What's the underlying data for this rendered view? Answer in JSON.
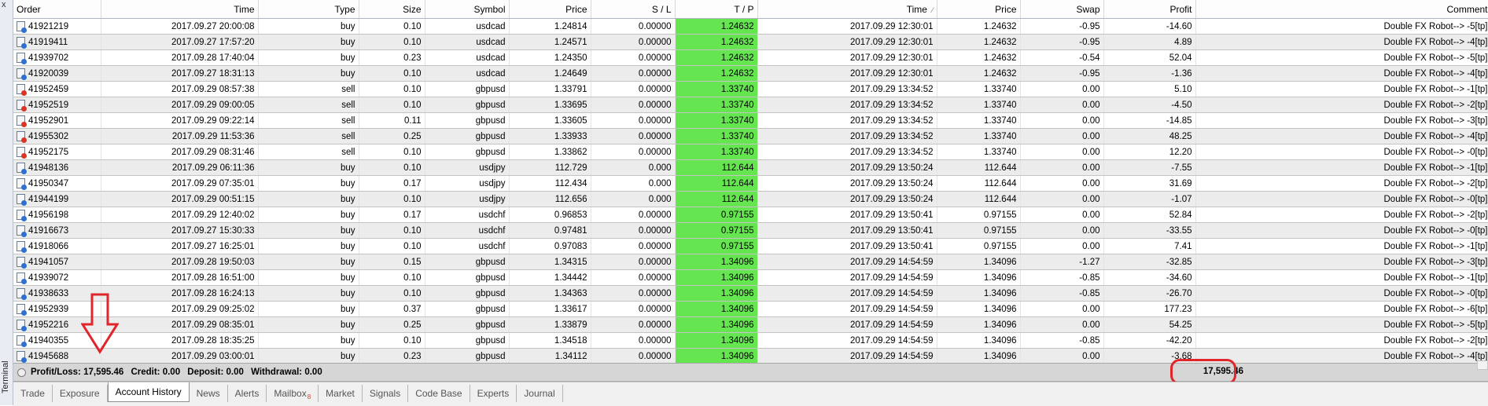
{
  "window": {
    "close_glyph": "x",
    "side_label": "Terminal"
  },
  "columns": [
    "Order",
    "Time",
    "Type",
    "Size",
    "Symbol",
    "Price",
    "S / L",
    "T / P",
    "Time",
    "Price",
    "Swap",
    "Profit",
    "Comment"
  ],
  "rows": [
    {
      "order": "41921219",
      "time": "2017.09.27 20:00:08",
      "type": "buy",
      "size": "0.10",
      "symbol": "usdcad",
      "price": "1.24814",
      "sl": "0.00000",
      "tp": "1.24632",
      "close_time": "2017.09.29 12:30:01",
      "close_price": "1.24632",
      "swap": "-0.95",
      "profit": "-14.60",
      "comment": "Double FX Robot--> -5[tp]"
    },
    {
      "order": "41919411",
      "time": "2017.09.27 17:57:20",
      "type": "buy",
      "size": "0.10",
      "symbol": "usdcad",
      "price": "1.24571",
      "sl": "0.00000",
      "tp": "1.24632",
      "close_time": "2017.09.29 12:30:01",
      "close_price": "1.24632",
      "swap": "-0.95",
      "profit": "4.89",
      "comment": "Double FX Robot--> -4[tp]"
    },
    {
      "order": "41939702",
      "time": "2017.09.28 17:40:04",
      "type": "buy",
      "size": "0.23",
      "symbol": "usdcad",
      "price": "1.24350",
      "sl": "0.00000",
      "tp": "1.24632",
      "close_time": "2017.09.29 12:30:01",
      "close_price": "1.24632",
      "swap": "-0.54",
      "profit": "52.04",
      "comment": "Double FX Robot--> -5[tp]"
    },
    {
      "order": "41920039",
      "time": "2017.09.27 18:31:13",
      "type": "buy",
      "size": "0.10",
      "symbol": "usdcad",
      "price": "1.24649",
      "sl": "0.00000",
      "tp": "1.24632",
      "close_time": "2017.09.29 12:30:01",
      "close_price": "1.24632",
      "swap": "-0.95",
      "profit": "-1.36",
      "comment": "Double FX Robot--> -4[tp]"
    },
    {
      "order": "41952459",
      "time": "2017.09.29 08:57:38",
      "type": "sell",
      "size": "0.10",
      "symbol": "gbpusd",
      "price": "1.33791",
      "sl": "0.00000",
      "tp": "1.33740",
      "close_time": "2017.09.29 13:34:52",
      "close_price": "1.33740",
      "swap": "0.00",
      "profit": "5.10",
      "comment": "Double FX Robot--> -1[tp]"
    },
    {
      "order": "41952519",
      "time": "2017.09.29 09:00:05",
      "type": "sell",
      "size": "0.10",
      "symbol": "gbpusd",
      "price": "1.33695",
      "sl": "0.00000",
      "tp": "1.33740",
      "close_time": "2017.09.29 13:34:52",
      "close_price": "1.33740",
      "swap": "0.00",
      "profit": "-4.50",
      "comment": "Double FX Robot--> -2[tp]"
    },
    {
      "order": "41952901",
      "time": "2017.09.29 09:22:14",
      "type": "sell",
      "size": "0.11",
      "symbol": "gbpusd",
      "price": "1.33605",
      "sl": "0.00000",
      "tp": "1.33740",
      "close_time": "2017.09.29 13:34:52",
      "close_price": "1.33740",
      "swap": "0.00",
      "profit": "-14.85",
      "comment": "Double FX Robot--> -3[tp]"
    },
    {
      "order": "41955302",
      "time": "2017.09.29 11:53:36",
      "type": "sell",
      "size": "0.25",
      "symbol": "gbpusd",
      "price": "1.33933",
      "sl": "0.00000",
      "tp": "1.33740",
      "close_time": "2017.09.29 13:34:52",
      "close_price": "1.33740",
      "swap": "0.00",
      "profit": "48.25",
      "comment": "Double FX Robot--> -4[tp]"
    },
    {
      "order": "41952175",
      "time": "2017.09.29 08:31:46",
      "type": "sell",
      "size": "0.10",
      "symbol": "gbpusd",
      "price": "1.33862",
      "sl": "0.00000",
      "tp": "1.33740",
      "close_time": "2017.09.29 13:34:52",
      "close_price": "1.33740",
      "swap": "0.00",
      "profit": "12.20",
      "comment": "Double FX Robot--> -0[tp]"
    },
    {
      "order": "41948136",
      "time": "2017.09.29 06:11:36",
      "type": "buy",
      "size": "0.10",
      "symbol": "usdjpy",
      "price": "112.729",
      "sl": "0.000",
      "tp": "112.644",
      "close_time": "2017.09.29 13:50:24",
      "close_price": "112.644",
      "swap": "0.00",
      "profit": "-7.55",
      "comment": "Double FX Robot--> -1[tp]"
    },
    {
      "order": "41950347",
      "time": "2017.09.29 07:35:01",
      "type": "buy",
      "size": "0.17",
      "symbol": "usdjpy",
      "price": "112.434",
      "sl": "0.000",
      "tp": "112.644",
      "close_time": "2017.09.29 13:50:24",
      "close_price": "112.644",
      "swap": "0.00",
      "profit": "31.69",
      "comment": "Double FX Robot--> -2[tp]"
    },
    {
      "order": "41944199",
      "time": "2017.09.29 00:51:15",
      "type": "buy",
      "size": "0.10",
      "symbol": "usdjpy",
      "price": "112.656",
      "sl": "0.000",
      "tp": "112.644",
      "close_time": "2017.09.29 13:50:24",
      "close_price": "112.644",
      "swap": "0.00",
      "profit": "-1.07",
      "comment": "Double FX Robot--> -0[tp]"
    },
    {
      "order": "41956198",
      "time": "2017.09.29 12:40:02",
      "type": "buy",
      "size": "0.17",
      "symbol": "usdchf",
      "price": "0.96853",
      "sl": "0.00000",
      "tp": "0.97155",
      "close_time": "2017.09.29 13:50:41",
      "close_price": "0.97155",
      "swap": "0.00",
      "profit": "52.84",
      "comment": "Double FX Robot--> -2[tp]"
    },
    {
      "order": "41916673",
      "time": "2017.09.27 15:30:33",
      "type": "buy",
      "size": "0.10",
      "symbol": "usdchf",
      "price": "0.97481",
      "sl": "0.00000",
      "tp": "0.97155",
      "close_time": "2017.09.29 13:50:41",
      "close_price": "0.97155",
      "swap": "0.00",
      "profit": "-33.55",
      "comment": "Double FX Robot--> -0[tp]"
    },
    {
      "order": "41918066",
      "time": "2017.09.27 16:25:01",
      "type": "buy",
      "size": "0.10",
      "symbol": "usdchf",
      "price": "0.97083",
      "sl": "0.00000",
      "tp": "0.97155",
      "close_time": "2017.09.29 13:50:41",
      "close_price": "0.97155",
      "swap": "0.00",
      "profit": "7.41",
      "comment": "Double FX Robot--> -1[tp]"
    },
    {
      "order": "41941057",
      "time": "2017.09.28 19:50:03",
      "type": "buy",
      "size": "0.15",
      "symbol": "gbpusd",
      "price": "1.34315",
      "sl": "0.00000",
      "tp": "1.34096",
      "close_time": "2017.09.29 14:54:59",
      "close_price": "1.34096",
      "swap": "-1.27",
      "profit": "-32.85",
      "comment": "Double FX Robot--> -3[tp]"
    },
    {
      "order": "41939072",
      "time": "2017.09.28 16:51:00",
      "type": "buy",
      "size": "0.10",
      "symbol": "gbpusd",
      "price": "1.34442",
      "sl": "0.00000",
      "tp": "1.34096",
      "close_time": "2017.09.29 14:54:59",
      "close_price": "1.34096",
      "swap": "-0.85",
      "profit": "-34.60",
      "comment": "Double FX Robot--> -1[tp]"
    },
    {
      "order": "41938633",
      "time": "2017.09.28 16:24:13",
      "type": "buy",
      "size": "0.10",
      "symbol": "gbpusd",
      "price": "1.34363",
      "sl": "0.00000",
      "tp": "1.34096",
      "close_time": "2017.09.29 14:54:59",
      "close_price": "1.34096",
      "swap": "-0.85",
      "profit": "-26.70",
      "comment": "Double FX Robot--> -0[tp]"
    },
    {
      "order": "41952939",
      "time": "2017.09.29 09:25:02",
      "type": "buy",
      "size": "0.37",
      "symbol": "gbpusd",
      "price": "1.33617",
      "sl": "0.00000",
      "tp": "1.34096",
      "close_time": "2017.09.29 14:54:59",
      "close_price": "1.34096",
      "swap": "0.00",
      "profit": "177.23",
      "comment": "Double FX Robot--> -6[tp]"
    },
    {
      "order": "41952216",
      "time": "2017.09.29 08:35:01",
      "type": "buy",
      "size": "0.25",
      "symbol": "gbpusd",
      "price": "1.33879",
      "sl": "0.00000",
      "tp": "1.34096",
      "close_time": "2017.09.29 14:54:59",
      "close_price": "1.34096",
      "swap": "0.00",
      "profit": "54.25",
      "comment": "Double FX Robot--> -5[tp]"
    },
    {
      "order": "41940355",
      "time": "2017.09.28 18:35:25",
      "type": "buy",
      "size": "0.10",
      "symbol": "gbpusd",
      "price": "1.34518",
      "sl": "0.00000",
      "tp": "1.34096",
      "close_time": "2017.09.29 14:54:59",
      "close_price": "1.34096",
      "swap": "-0.85",
      "profit": "-42.20",
      "comment": "Double FX Robot--> -2[tp]"
    },
    {
      "order": "41945688",
      "time": "2017.09.29 03:00:01",
      "type": "buy",
      "size": "0.23",
      "symbol": "gbpusd",
      "price": "1.34112",
      "sl": "0.00000",
      "tp": "1.34096",
      "close_time": "2017.09.29 14:54:59",
      "close_price": "1.34096",
      "swap": "0.00",
      "profit": "-3.68",
      "comment": "Double FX Robot--> -4[tp]"
    }
  ],
  "summary": {
    "profit_loss": "Profit/Loss: 17,595.46",
    "credit": "Credit: 0.00",
    "deposit": "Deposit: 0.00",
    "withdrawal": "Withdrawal: 0.00",
    "total_profit": "17,595.46"
  },
  "tabs": [
    {
      "label": "Trade"
    },
    {
      "label": "Exposure"
    },
    {
      "label": "Account History",
      "active": true
    },
    {
      "label": "News"
    },
    {
      "label": "Alerts"
    },
    {
      "label": "Mailbox",
      "badge": "8"
    },
    {
      "label": "Market"
    },
    {
      "label": "Signals"
    },
    {
      "label": "Code Base"
    },
    {
      "label": "Experts"
    },
    {
      "label": "Journal"
    }
  ],
  "colors": {
    "tp_highlight": "#65e650",
    "annotation": "#e0262b",
    "buy_icon": "#2e6fd3",
    "sell_icon": "#dd3322"
  }
}
